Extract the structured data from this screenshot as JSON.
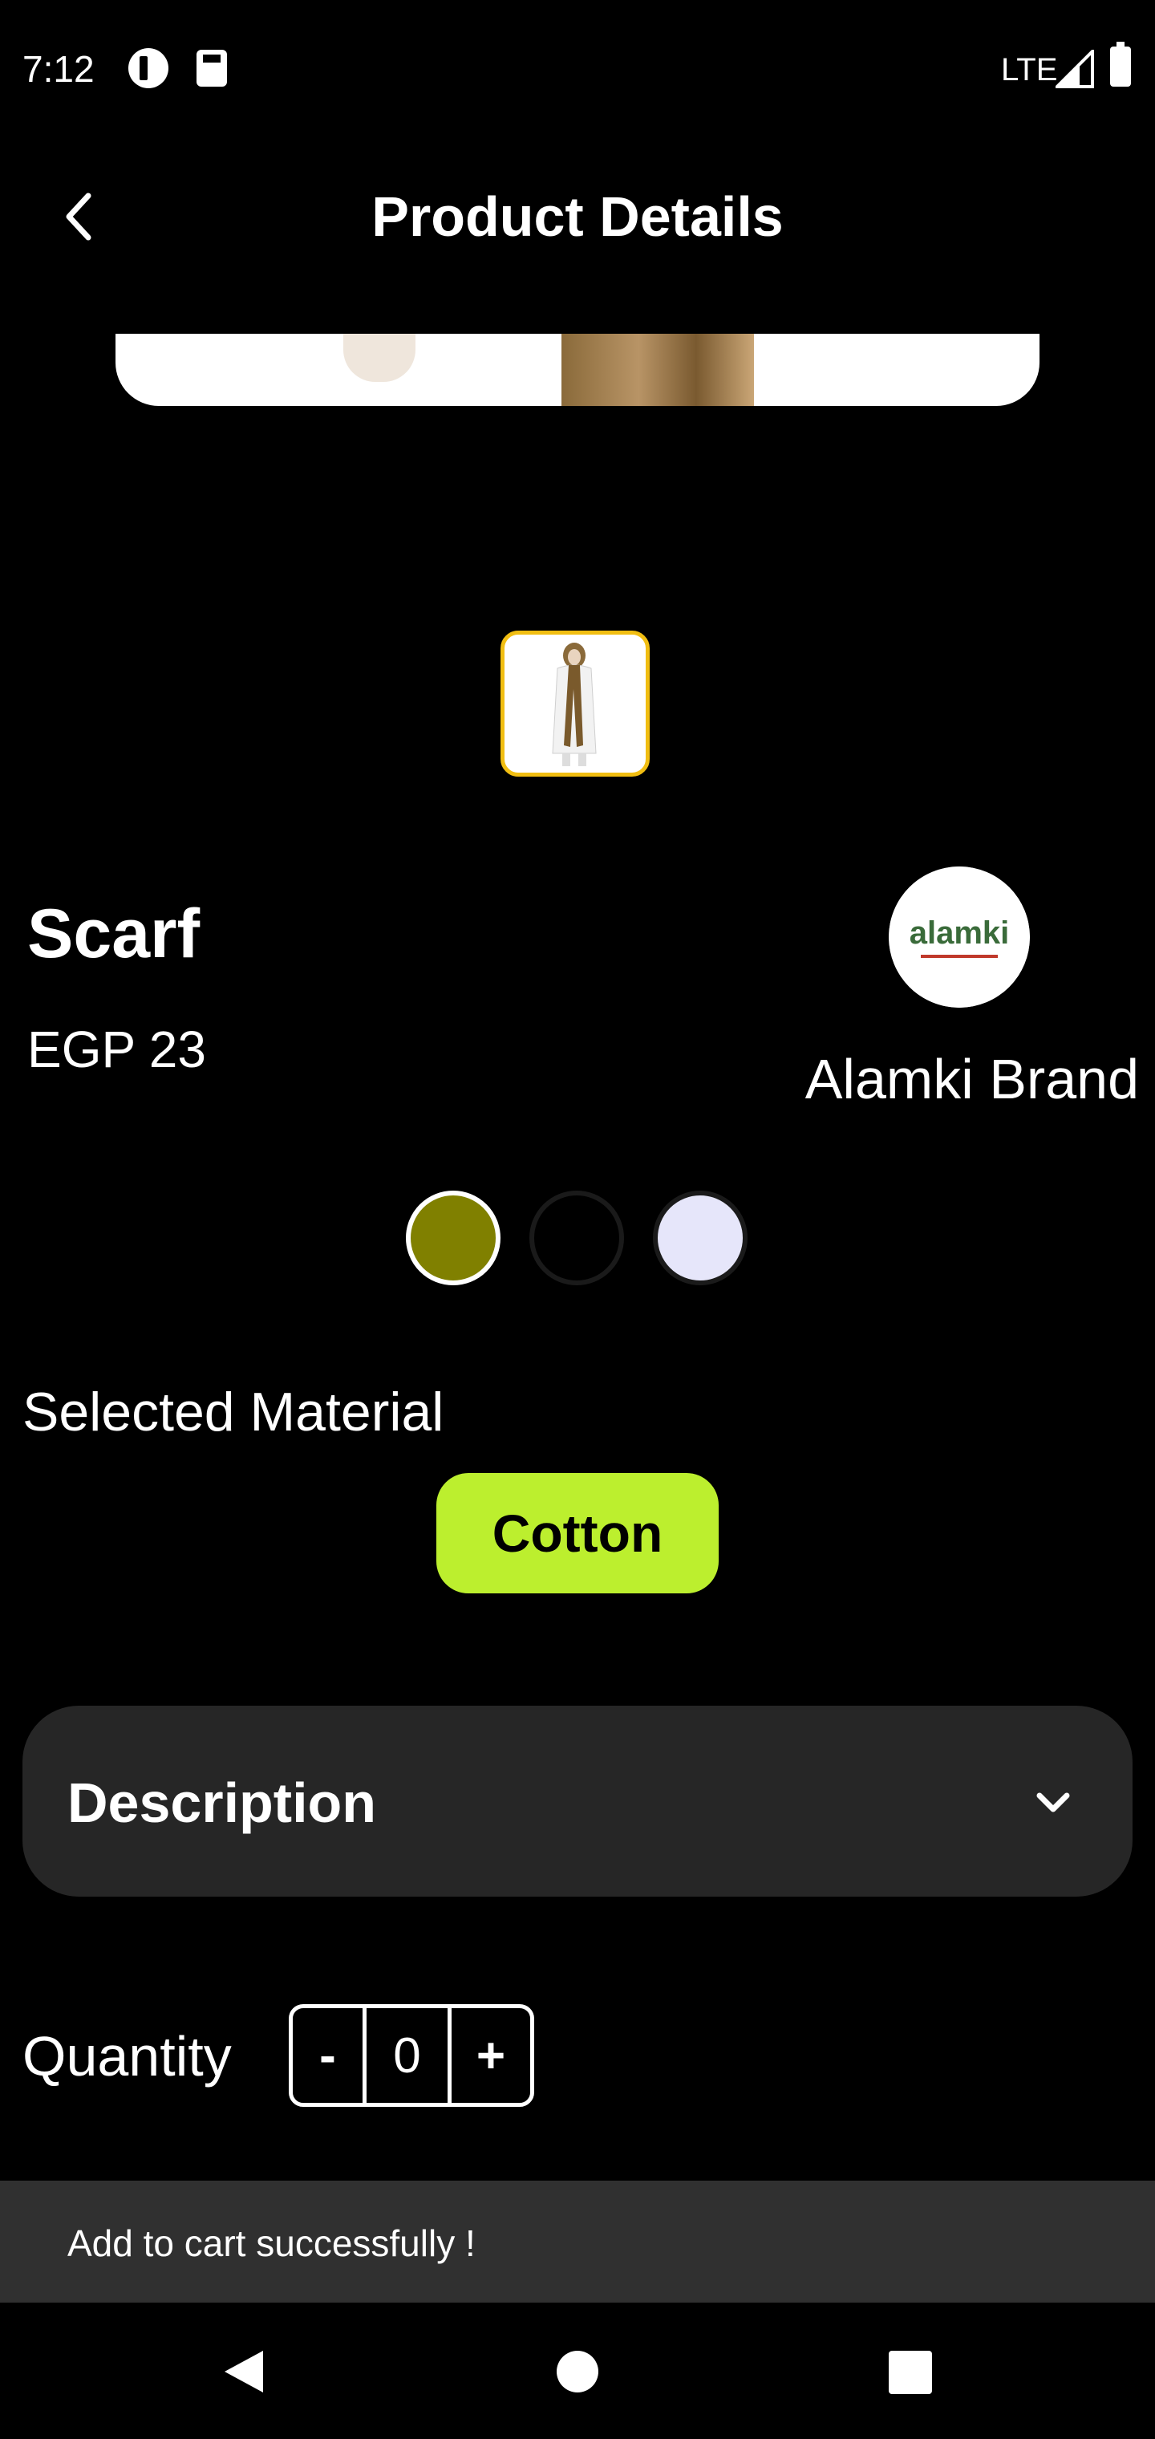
{
  "status_bar": {
    "time": "7:12",
    "network": "LTE"
  },
  "header": {
    "title": "Product Details"
  },
  "product": {
    "name": "Scarf",
    "price": "EGP 23",
    "brand": "Alamki Brand",
    "brand_logo_text": "alamki",
    "colors": [
      "#808000",
      "#000000",
      "#e6e6fa"
    ],
    "selected_color_index": 0
  },
  "material": {
    "label": "Selected Material",
    "selected": "Cotton"
  },
  "description": {
    "title": "Description"
  },
  "quantity": {
    "label": "Quantity",
    "minus": "-",
    "value": "0",
    "plus": "+"
  },
  "snackbar": {
    "message": "Add to cart successfully !"
  },
  "theme": {
    "accent": "#bcef2e",
    "thumbnail_border": "#f1be12",
    "panel": "#262626"
  }
}
